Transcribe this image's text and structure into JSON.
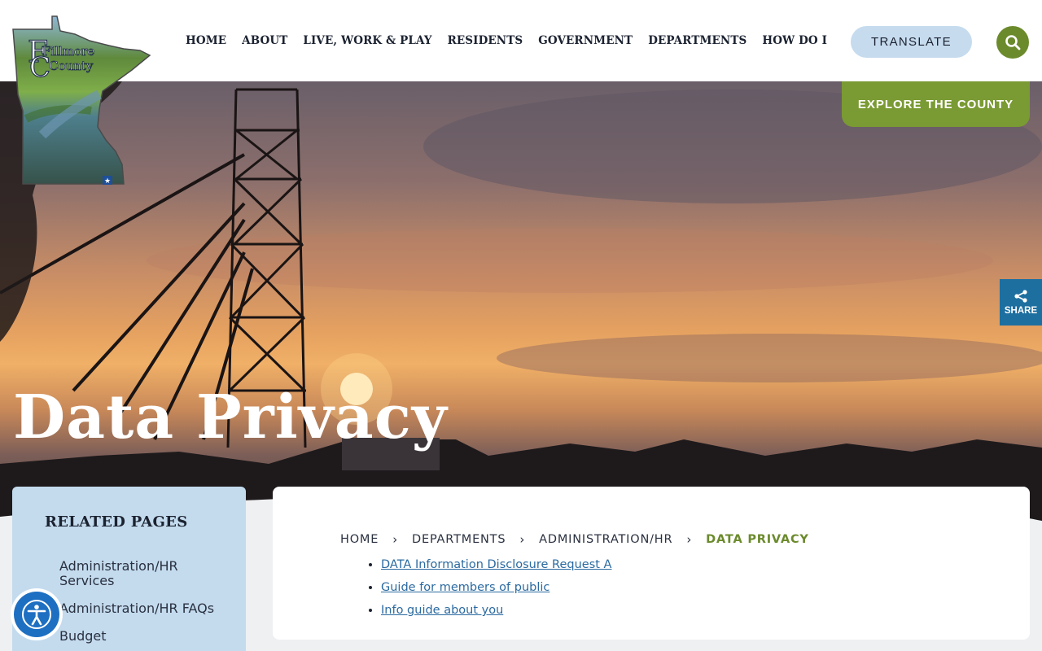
{
  "logo": {
    "text_line1": "Fillmore",
    "text_line2": "County",
    "name": "fillmore-county-logo"
  },
  "nav": {
    "items": [
      "HOME",
      "ABOUT",
      "LIVE, WORK & PLAY",
      "RESIDENTS",
      "GOVERNMENT",
      "DEPARTMENTS",
      "HOW DO I"
    ]
  },
  "header": {
    "translate_label": "TRANSLATE",
    "search_icon": "search-icon"
  },
  "hero": {
    "explore_label": "EXPLORE THE COUNTY",
    "share_label": "SHARE",
    "title": "Data Privacy"
  },
  "sidebar": {
    "heading": "RELATED PAGES",
    "links": [
      "Administration/HR Services",
      "Administration/HR FAQs",
      "Budget"
    ]
  },
  "breadcrumb": {
    "items": [
      "HOME",
      "DEPARTMENTS",
      "ADMINISTRATION/HR"
    ],
    "current": "DATA PRIVACY"
  },
  "documents": [
    "DATA Information Disclosure Request A",
    "Guide for members of public",
    "Info guide about you"
  ],
  "colors": {
    "accent_green": "#6b8a2c",
    "explore_green": "#7a9a33",
    "translate_blue": "#c6dbee",
    "share_blue": "#1d6fa0",
    "link_blue": "#2b6aa0",
    "accessibility_blue": "#1d6fc2"
  }
}
